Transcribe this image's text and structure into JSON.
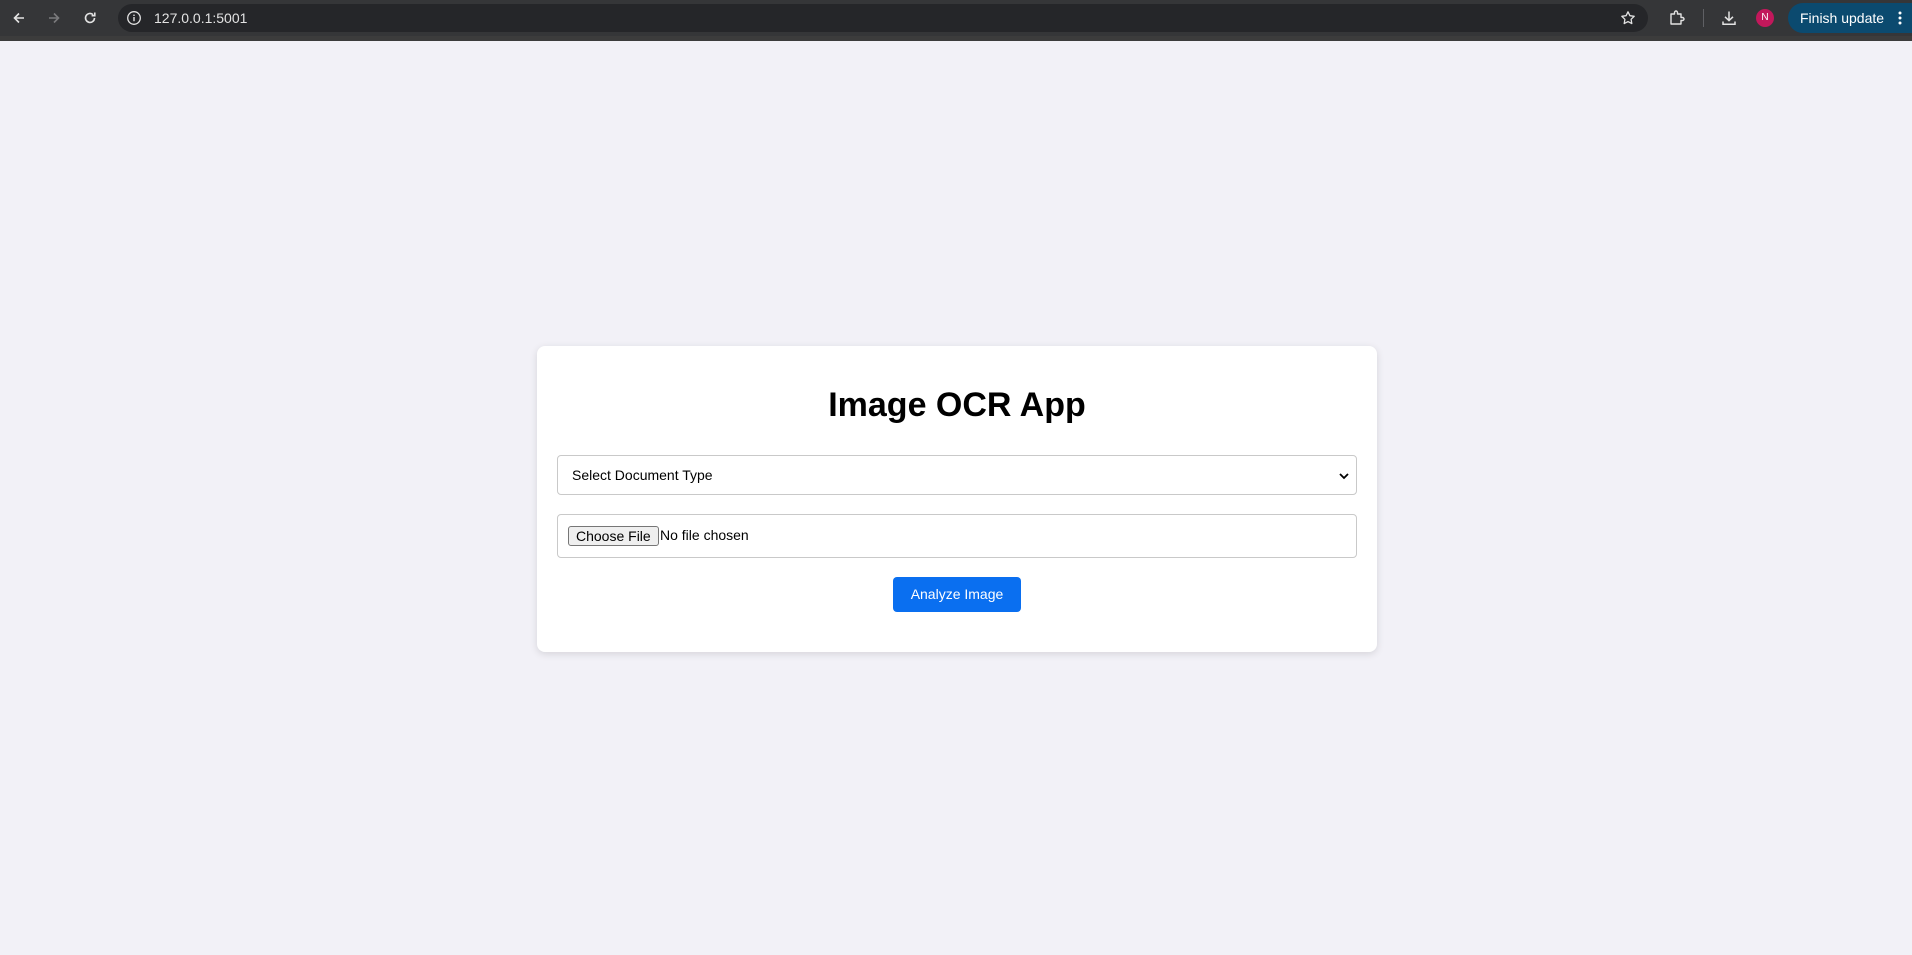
{
  "browser": {
    "url": "127.0.0.1:5001",
    "profile_initial": "N",
    "update_label": "Finish update",
    "icons": {
      "back": "back-arrow-icon",
      "forward": "forward-arrow-icon",
      "reload": "reload-icon",
      "site_info": "info-icon",
      "bookmark": "star-icon",
      "extensions": "puzzle-icon",
      "downloads": "download-icon",
      "menu": "kebab-menu-icon"
    }
  },
  "app": {
    "title": "Image OCR App",
    "document_type_select": {
      "selected": "Select Document Type"
    },
    "file_input": {
      "button_label": "Choose File",
      "status": "No file chosen"
    },
    "analyze_label": "Analyze Image"
  },
  "colors": {
    "page_background": "#f2f1f7",
    "primary_button": "#0a6ff0",
    "update_button": "#0b4a6f",
    "avatar": "#c2185b"
  }
}
